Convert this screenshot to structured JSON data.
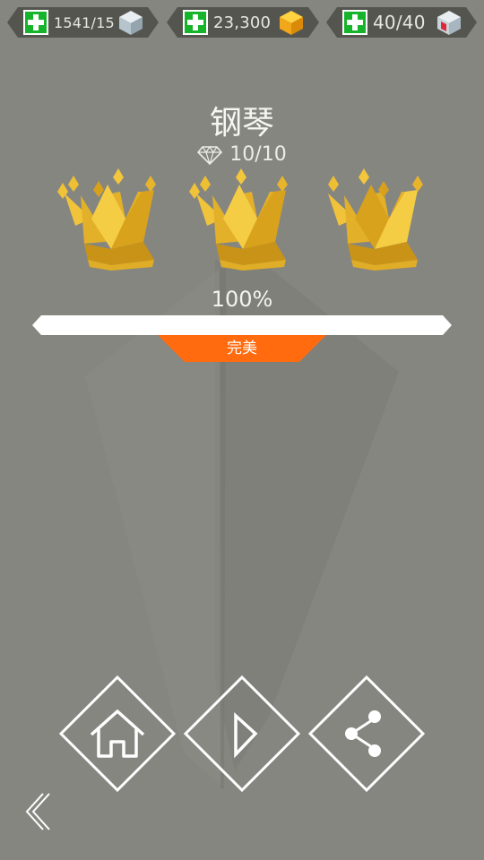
{
  "hud": {
    "resource1": "1541/15",
    "coins": "23,300",
    "energy": "40/40"
  },
  "level": {
    "title": "钢琴",
    "gems": "10/10"
  },
  "result": {
    "crowns_earned": 3,
    "percent_text": "100%",
    "progress_fraction": 1.0,
    "rating": "完美"
  },
  "icons": {
    "plus": "plus-icon",
    "cube": "cube-icon",
    "coin": "gold-cube-icon",
    "energy": "energy-cube-icon",
    "diamond": "diamond-icon",
    "crown": "crown-icon",
    "home": "home-icon",
    "play": "play-icon",
    "share": "share-icon",
    "back": "back-chevron-icon"
  },
  "colors": {
    "background": "#868680",
    "plus_green": "#15b42a",
    "rating_orange": "#ff6b0e",
    "crown_gold": "#e9b92b"
  }
}
